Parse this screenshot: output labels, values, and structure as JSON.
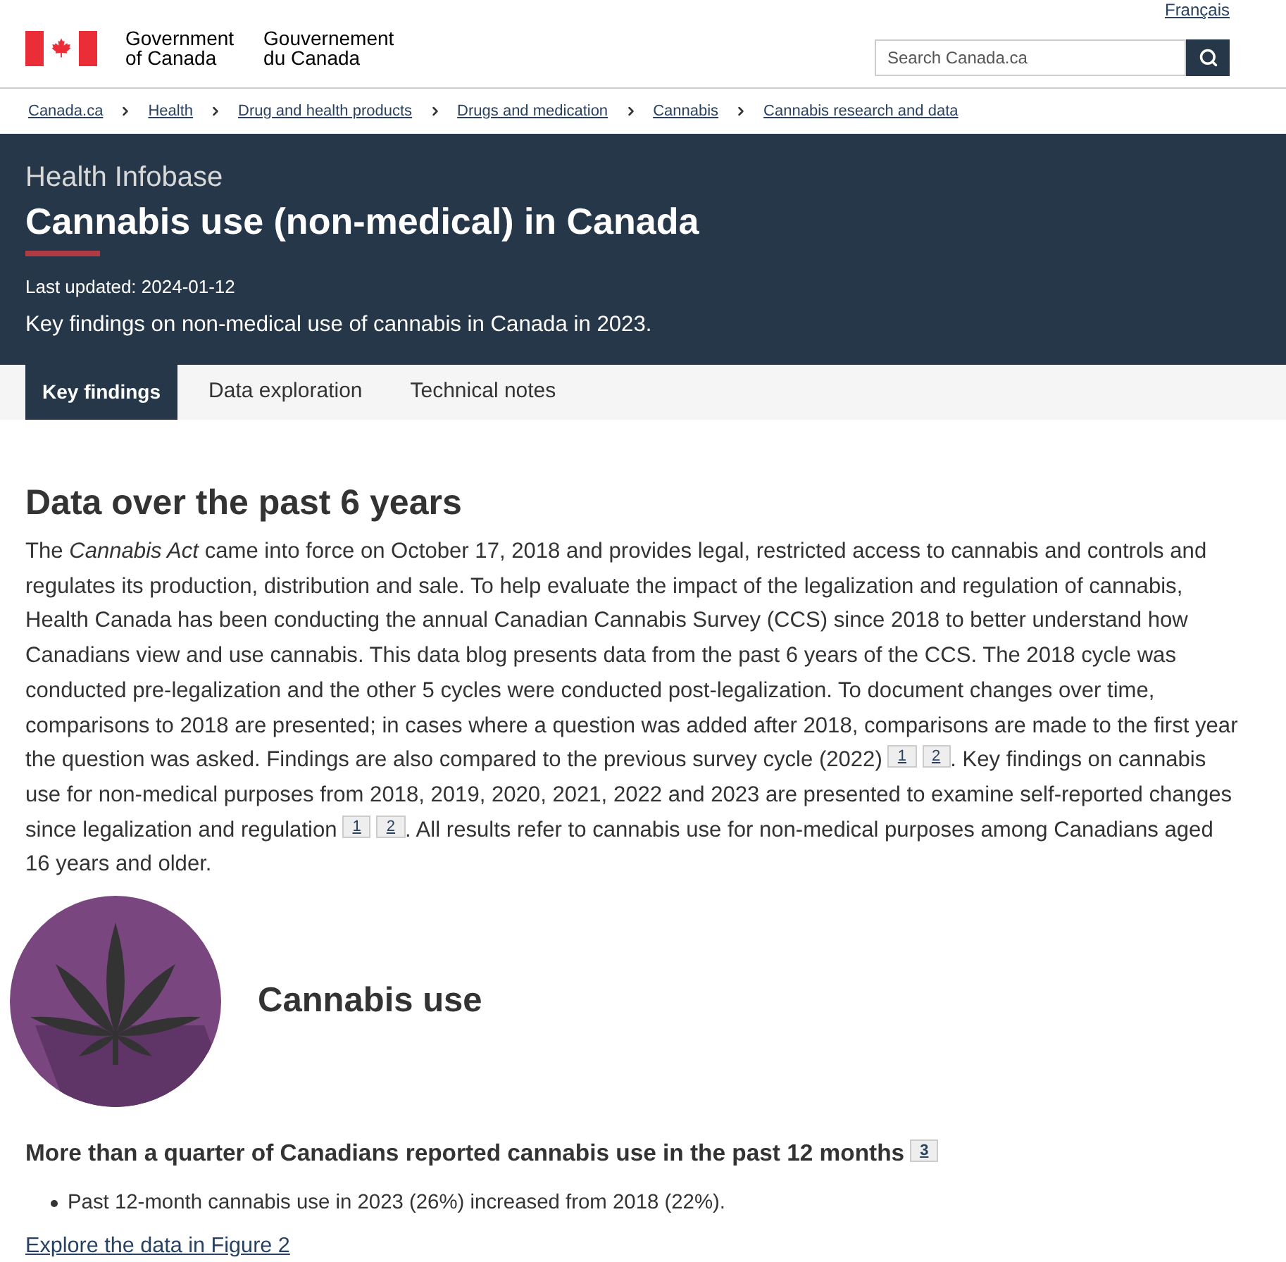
{
  "header": {
    "language_link": "Français",
    "wordmark_en": [
      "Government",
      "of Canada"
    ],
    "wordmark_fr": [
      "Gouvernement",
      "du Canada"
    ],
    "search": {
      "placeholder": "Search Canada.ca"
    }
  },
  "breadcrumb": [
    "Canada.ca",
    "Health",
    "Drug and health products",
    "Drugs and medication",
    "Cannabis",
    "Cannabis research and data"
  ],
  "banner": {
    "eyebrow": "Health Infobase",
    "title": "Cannabis use (non-medical) in Canada",
    "last_updated": "Last updated: 2024-01-12",
    "summary": "Key findings on non-medical use of cannabis in Canada in 2023."
  },
  "tabs": [
    {
      "label": "Key findings",
      "selected": true
    },
    {
      "label": "Data exploration",
      "selected": false
    },
    {
      "label": "Technical notes",
      "selected": false
    }
  ],
  "intro": {
    "heading": "Data over the past 6 years",
    "paragraph": [
      {
        "kind": "text",
        "text": "The *Cannabis Act* came into force on October 17, 2018 and provides legal, restricted access to cannabis and controls and regulates its production, distribution and sale. To help evaluate the impact of the legalization and regulation of cannabis, Health Canada has been conducting the annual Canadian Cannabis Survey (CCS) since 2018 to better understand how Canadians view and use cannabis. This data blog presents data from the past 6 years of the CCS. The 2018 cycle was conducted pre-legalization and the other 5 cycles were conducted post-legalization. To document changes over time, comparisons to 2018 are presented; in cases where a question was added after 2018, comparisons are made to the first year the question was asked. Findings are also compared to the previous survey cycle (2022)"
      },
      {
        "kind": "footnote",
        "text": "1"
      },
      {
        "kind": "footnote",
        "text": "2"
      },
      {
        "kind": "text",
        "text": ". Key findings on cannabis use for non-medical purposes from 2018, 2019, 2020, 2021, 2022 and 2023 are presented to examine self-reported changes since legalization and regulation"
      },
      {
        "kind": "footnote",
        "text": "1"
      },
      {
        "kind": "footnote",
        "text": "2"
      },
      {
        "kind": "text",
        "text": ". All results refer to cannabis use for non-medical purposes among Canadians aged 16 years and older."
      }
    ]
  },
  "section": {
    "heading": "Cannabis use",
    "finding": {
      "heading": "More than a quarter of Canadians reported cannabis use in the past 12 months",
      "footnote": "3"
    },
    "bullets": [
      "Past 12-month cannabis use in 2023 (26%) increased from 2018 (22%)."
    ],
    "link": "Explore the data in Figure 2"
  }
}
